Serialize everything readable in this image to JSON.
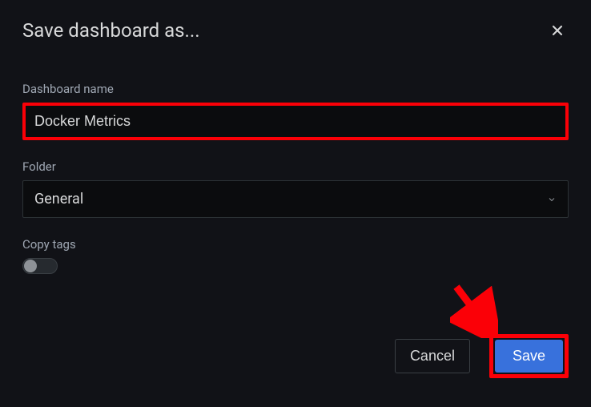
{
  "header": {
    "title": "Save dashboard as..."
  },
  "form": {
    "dashboard_name": {
      "label": "Dashboard name",
      "value": "Docker Metrics"
    },
    "folder": {
      "label": "Folder",
      "selected": "General"
    },
    "copy_tags": {
      "label": "Copy tags"
    }
  },
  "footer": {
    "cancel_label": "Cancel",
    "save_label": "Save"
  }
}
